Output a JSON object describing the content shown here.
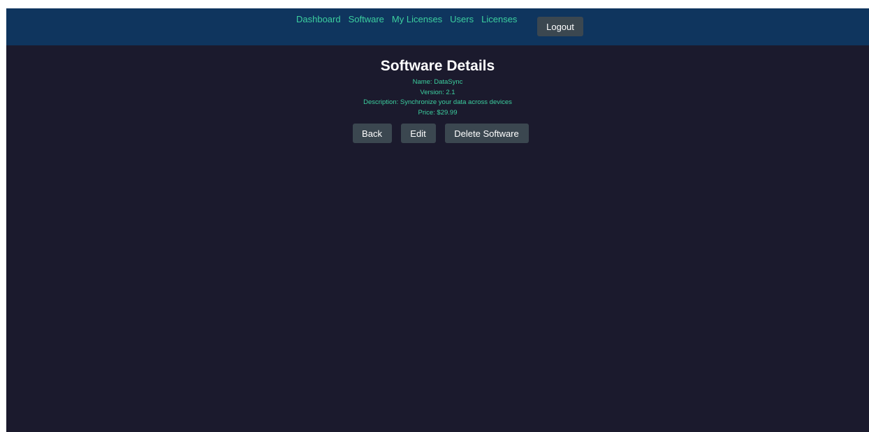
{
  "nav": {
    "links": [
      "Dashboard",
      "Software",
      "My Licenses",
      "Users",
      "Licenses"
    ],
    "logout_label": "Logout"
  },
  "page": {
    "title": "Software Details",
    "details": {
      "name": "Name: DataSync",
      "version": "Version: 2.1",
      "description": "Description: Synchronize your data across devices",
      "price": "Price: $29.99"
    },
    "actions": {
      "back": "Back",
      "edit": "Edit",
      "delete": "Delete Software"
    }
  },
  "colors": {
    "navbar": "#0f355e",
    "background": "#1b1a2d",
    "accent_text": "#3ccf9f",
    "button": "#3b4750"
  }
}
